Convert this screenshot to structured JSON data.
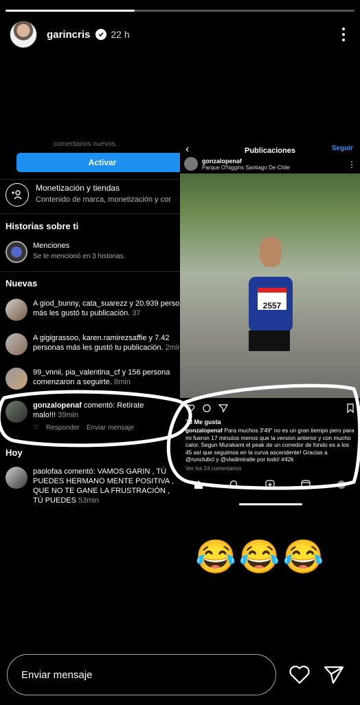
{
  "story": {
    "username": "garincris",
    "time": "22 h",
    "progress_fraction": 0.37
  },
  "left": {
    "cut_text": "comentarios nuevos.",
    "activate_button": "Activar",
    "monetization": {
      "title": "Monetización y tiendas",
      "subtitle": "Contenido de marca, monetización y cor"
    },
    "section_stories": "Historias sobre ti",
    "mentions": {
      "title": "Menciones",
      "subtitle": "Se te mencionó en 3 historias."
    },
    "section_new": "Nuevas",
    "notifications": [
      {
        "user": "A giod_bunny, cata_suarezz y 20.939",
        "text": "personas más les gustó tu publicación.",
        "time": "37"
      },
      {
        "user": "A gigigrassoo, karen.ramirezsaffie y 7.42",
        "text": "personas más les gustó tu publicación.",
        "time": "2min"
      },
      {
        "user": "99_vnnii, pia_valentina_cf y 156 persona",
        "text": "comenzaron a seguirte.",
        "time": "8min"
      }
    ],
    "comment": {
      "user": "gonzalopenaf",
      "text": "comentó: Retírate malo!!!",
      "time": "39min",
      "reply": "Responder",
      "send": "Enviar mensaje"
    },
    "section_today": "Hoy",
    "today_comment": {
      "user": "paolofaa",
      "text": "comentó: VAMOS GARIN , TÚ PUEDES HERMANO MENTE POSITIVA , QUE NO TE GANE LA FRUSTRACIÓN , TÚ PUEDES",
      "time": "53min"
    }
  },
  "right": {
    "title": "Publicaciones",
    "follow": "Seguir",
    "user": "gonzalopenaf",
    "location": "Parque O'higgins Santiago De Chile",
    "bib_number": "2557",
    "likes": "78 Me gusta",
    "caption_user": "gonzalopenaf",
    "caption": "Para muchos 3'49\" no es un gran tiempo pero para mi fueron 17 minutos menos que la version anterior y con mucho calor. Segun Murakami el peak de un corredor de fondo es a los 45 así que seguimos en la curva ascendente! Gracias a @runclubcl y @vladimiratle por todo! #42k",
    "comments": "Ver los 24 comentarios"
  },
  "emojis": [
    "😂",
    "😂",
    "😂"
  ],
  "bottom": {
    "placeholder": "Enviar mensaje"
  }
}
